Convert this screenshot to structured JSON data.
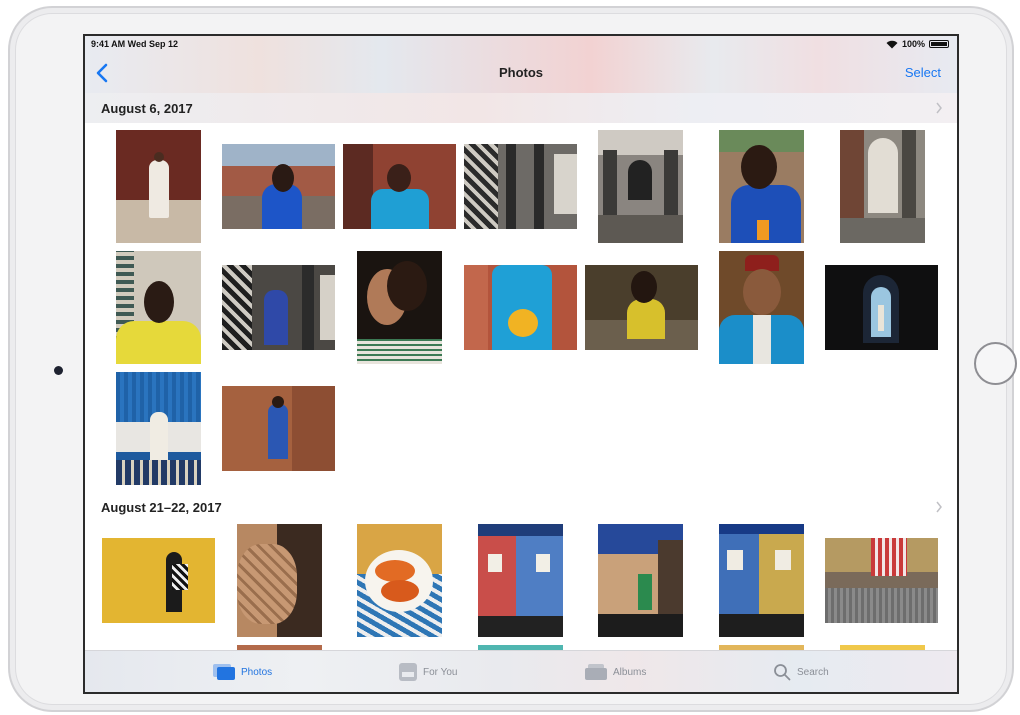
{
  "status": {
    "time": "9:41 AM  Wed Sep 12",
    "battery": "100%"
  },
  "nav": {
    "title": "Photos",
    "select_label": "Select"
  },
  "sections": [
    {
      "title": "August 6, 2017"
    },
    {
      "title": "August 21–22, 2017"
    }
  ],
  "tabs": [
    {
      "label": "Photos",
      "icon": "photos-icon",
      "active": true
    },
    {
      "label": "For You",
      "icon": "for-you-icon",
      "active": false
    },
    {
      "label": "Albums",
      "icon": "albums-icon",
      "active": false
    },
    {
      "label": "Search",
      "icon": "search-icon",
      "active": false
    }
  ],
  "colors": {
    "accent": "#1877f2",
    "tab_active": "#2274e0",
    "tab_inactive": "#8b8f97"
  }
}
